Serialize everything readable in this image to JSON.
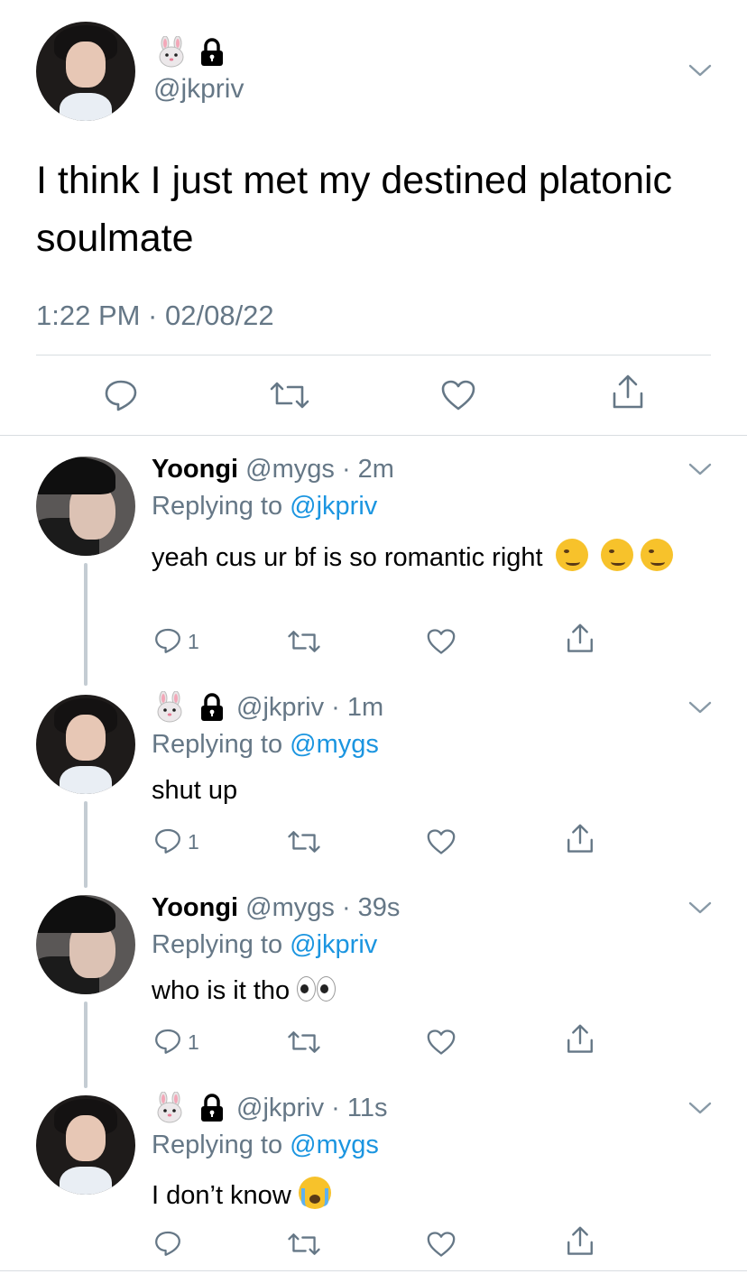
{
  "main_tweet": {
    "display_emoji": "bunny-face-emoji",
    "lock": "lock-icon",
    "handle": "@jkpriv",
    "text": "I think I just met my destined platonic soulmate",
    "timestamp": "1:22 PM · 02/08/22"
  },
  "replies": [
    {
      "name": "Yoongi",
      "handle_time": "@mygs · 2m",
      "replying_prefix": "Replying to",
      "replying_to": "@jkpriv",
      "text": "yeah cus ur bf is so romantic right",
      "emojis": [
        "woozy-face",
        "woozy-face",
        "woozy-face"
      ],
      "reply_count": "1"
    },
    {
      "name": "",
      "handle_time": "@jkpriv · 1m",
      "replying_prefix": "Replying to",
      "replying_to": "@mygs",
      "text": "shut up",
      "reply_count": "1"
    },
    {
      "name": "Yoongi",
      "handle_time": "@mygs · 39s",
      "replying_prefix": "Replying to",
      "replying_to": "@jkpriv",
      "text": "who is it tho",
      "emojis": [
        "eyes"
      ],
      "reply_count": "1"
    },
    {
      "name": "",
      "handle_time": "@jkpriv · 11s",
      "replying_prefix": "Replying to",
      "replying_to": "@mygs",
      "text": "I don’t know",
      "emojis": [
        "loudly-crying-face"
      ],
      "reply_count": ""
    }
  ],
  "colors": {
    "text": "#000000",
    "muted": "#657786",
    "link": "#1b95e0",
    "divider": "#d8dde1",
    "thread_line": "#c4ccd3"
  }
}
